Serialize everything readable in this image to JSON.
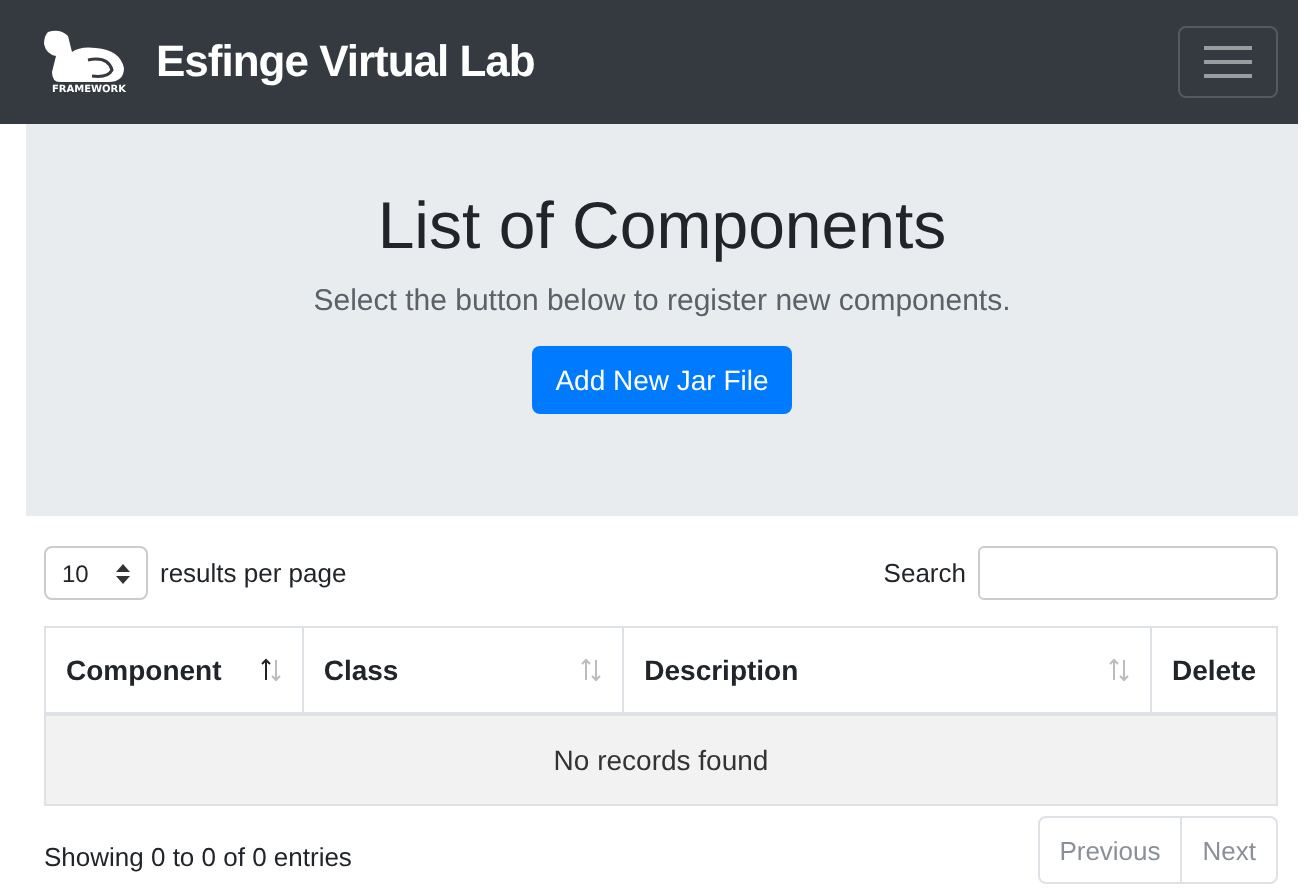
{
  "navbar": {
    "brand": "Esfinge Virtual Lab",
    "logo_caption": "FRAMEWORK"
  },
  "hero": {
    "title": "List of Components",
    "subtitle": "Select the button below to register new components.",
    "button": "Add New Jar File"
  },
  "table_controls": {
    "page_size": "10",
    "page_size_label": "results per page",
    "search_label": "Search"
  },
  "table": {
    "columns": [
      {
        "label": "Component",
        "sortable": true,
        "sorted": true
      },
      {
        "label": "Class",
        "sortable": true,
        "sorted": false
      },
      {
        "label": "Description",
        "sortable": true,
        "sorted": false
      },
      {
        "label": "Delete",
        "sortable": false,
        "sorted": false
      }
    ],
    "empty_message": "No records found"
  },
  "footer": {
    "info": "Showing 0 to 0 of 0 entries",
    "pagination": [
      {
        "label": "Previous",
        "disabled": true
      },
      {
        "label": "Next",
        "disabled": true
      }
    ]
  }
}
